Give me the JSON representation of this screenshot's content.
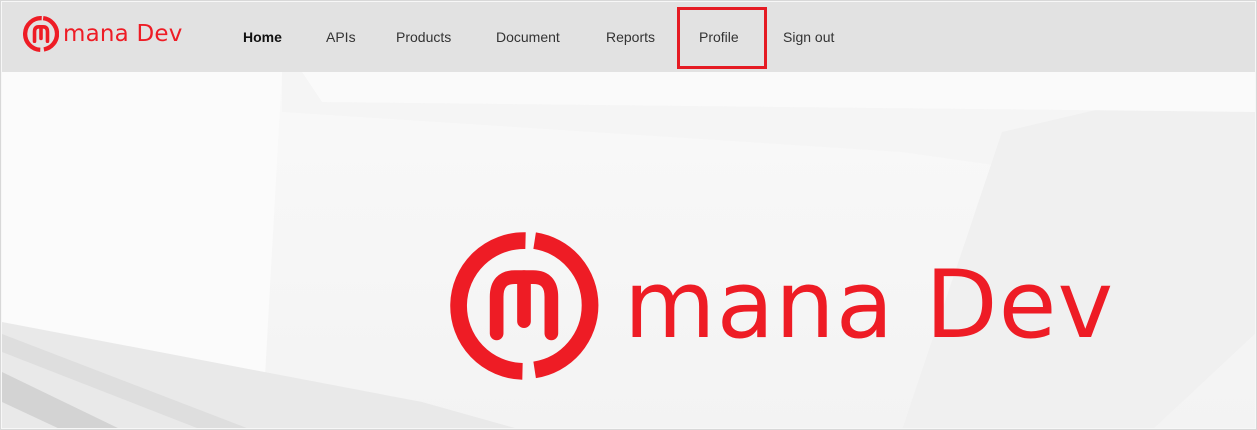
{
  "brand": {
    "name": "mana",
    "suffix": "Dev",
    "logo_icon": "mana-circle-m-logo-icon",
    "color": "#ee1c25"
  },
  "nav": {
    "items": [
      {
        "label": "Home",
        "active": true
      },
      {
        "label": "APIs"
      },
      {
        "label": "Products"
      },
      {
        "label": "Document"
      },
      {
        "label": "Reports"
      },
      {
        "label": "Profile",
        "highlighted": true
      },
      {
        "label": "Sign out"
      }
    ],
    "highlight_color": "#e51b23"
  },
  "hero": {
    "name": "mana",
    "suffix": "Dev"
  }
}
